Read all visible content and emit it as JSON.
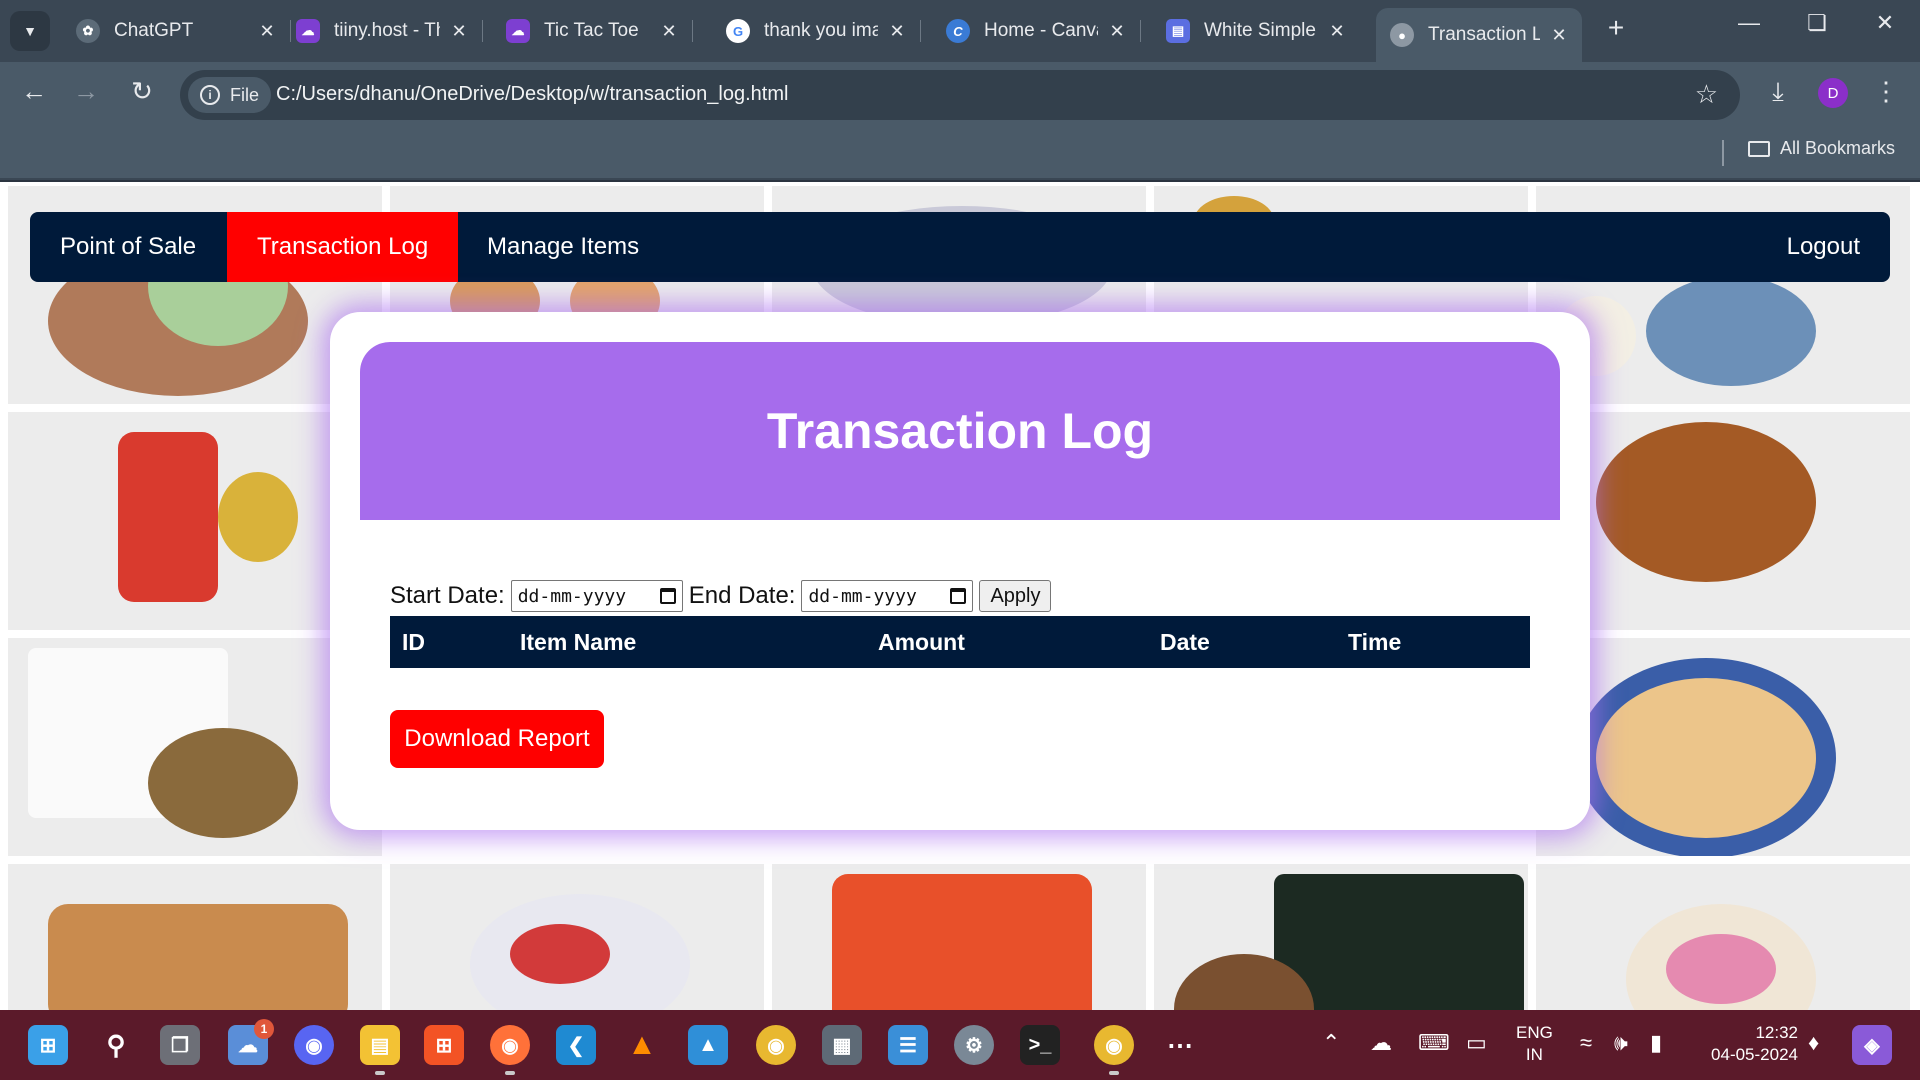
{
  "browser": {
    "tabs": [
      {
        "title": "ChatGPT",
        "icon": "chatgpt-icon"
      },
      {
        "title": "tiiny.host - The",
        "icon": "tiiny-icon"
      },
      {
        "title": "Tic Tac Toe",
        "icon": "tiiny-icon"
      },
      {
        "title": "thank you ima",
        "icon": "google-icon"
      },
      {
        "title": "Home - Canva",
        "icon": "canva-icon"
      },
      {
        "title": "White Simple",
        "icon": "doc-icon"
      },
      {
        "title": "Transaction Lo",
        "icon": "globe-icon",
        "active": true
      }
    ],
    "address": {
      "chip_label": "File",
      "url": "C:/Users/dhanu/OneDrive/Desktop/w/transaction_log.html"
    },
    "profile_initial": "D",
    "bookmarks_label": "All Bookmarks"
  },
  "page": {
    "nav": {
      "links": [
        "Point of Sale",
        "Transaction Log",
        "Manage Items"
      ],
      "active": "Transaction Log",
      "logout": "Logout"
    },
    "title": "Transaction Log",
    "filters": {
      "start_label": "Start Date:",
      "end_label": "End Date:",
      "date_placeholder": "dd-mm-yyyy",
      "apply_label": "Apply"
    },
    "table": {
      "columns": [
        "ID",
        "Item Name",
        "Amount",
        "Date",
        "Time"
      ],
      "rows": []
    },
    "download_label": "Download Report"
  },
  "taskbar": {
    "notification_count": "1",
    "language": "ENG",
    "region": "IN",
    "time": "12:32",
    "date": "04-05-2024"
  },
  "colors": {
    "navbar": "#001a3a",
    "nav_active": "#ff0000",
    "header": "#a66cec",
    "download_button": "#ff0000"
  }
}
